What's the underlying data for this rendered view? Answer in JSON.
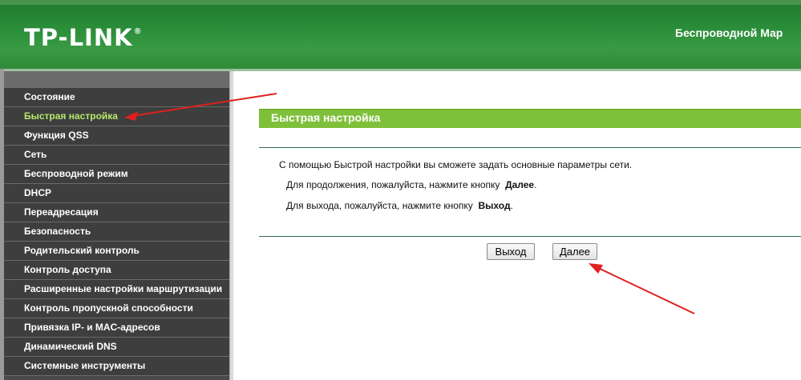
{
  "header": {
    "logo": "TP-LINK",
    "logo_mark": "®",
    "model_title": "Беспроводной Мар"
  },
  "sidebar": {
    "items": [
      {
        "label": "Состояние",
        "active": false
      },
      {
        "label": "Быстрая настройка",
        "active": true
      },
      {
        "label": "Функция QSS",
        "active": false
      },
      {
        "label": "Сеть",
        "active": false
      },
      {
        "label": "Беспроводной режим",
        "active": false
      },
      {
        "label": "DHCP",
        "active": false
      },
      {
        "label": "Переадресация",
        "active": false
      },
      {
        "label": "Безопасность",
        "active": false
      },
      {
        "label": "Родительский контроль",
        "active": false
      },
      {
        "label": "Контроль доступа",
        "active": false
      },
      {
        "label": "Расширенные настройки маршрутизации",
        "active": false
      },
      {
        "label": "Контроль пропускной способности",
        "active": false
      },
      {
        "label": "Привязка IP- и MAC-адресов",
        "active": false
      },
      {
        "label": "Динамический DNS",
        "active": false
      },
      {
        "label": "Системные инструменты",
        "active": false
      }
    ]
  },
  "main": {
    "title": "Быстрая настройка",
    "intro": "С помощью Быстрой настройки вы сможете задать основные параметры сети.",
    "continue_prefix": "Для продолжения, пожалуйста, нажмите кнопку",
    "continue_button_ref": "Далее",
    "exit_prefix": "Для выхода, пожалуйста, нажмите кнопку",
    "exit_button_ref": "Выход",
    "exit_button": "Выход",
    "next_button": "Далее"
  },
  "colors": {
    "header_green": "#2c8f3a",
    "title_bar_green": "#7fc03a",
    "active_menu_text": "#b6e86c",
    "sidebar_bg": "#3e3e3e",
    "annotation_arrow": "#e02020"
  }
}
